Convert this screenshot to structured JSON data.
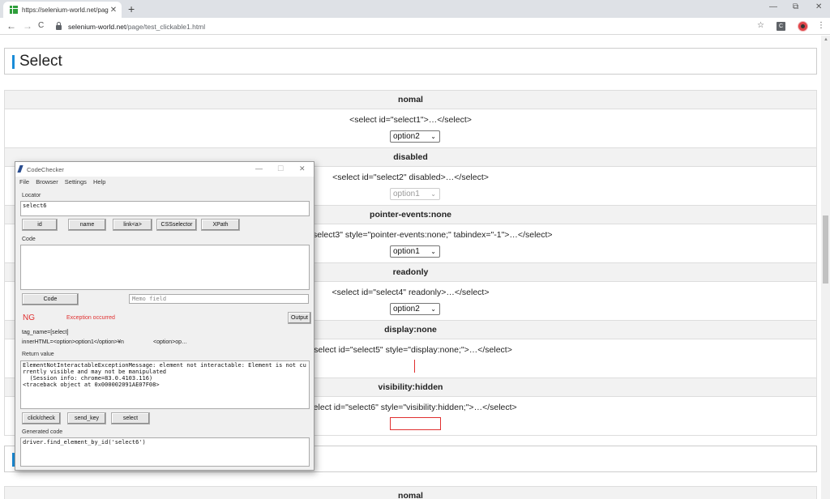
{
  "browser": {
    "tab_title": "https://selenium-world.net/page",
    "tab_close": "✕",
    "new_tab": "+",
    "url_host": "selenium-world.net",
    "url_path": "/page/test_clickable1.html",
    "back": "←",
    "forward": "→",
    "reload": "C",
    "star": "☆",
    "ext_label": "C",
    "menu": "⋮",
    "minimize": "—",
    "restore": "⧉",
    "close": "✕"
  },
  "page": {
    "section_title": "Select",
    "rows": [
      {
        "head": "nomal",
        "code": "<select id=\"select1\">…</select>",
        "select": "option2"
      },
      {
        "head": "disabled",
        "code": "<select id=\"select2\" disabled>…</select>",
        "select": "option1"
      },
      {
        "head": "pointer-events:none",
        "code": "<select id=\"select3\" style=\"pointer-events:none;\" tabindex=\"-1\">…</select>",
        "select": "option1"
      },
      {
        "head": "readonly",
        "code": "<select id=\"select4\" readonly>…</select>",
        "select": "option2"
      },
      {
        "head": "display:none",
        "code": "<select id=\"select5\" style=\"display:none;\">…</select>"
      },
      {
        "head": "visibility:hidden",
        "code": "<select id=\"select6\" style=\"visibility:hidden;\">…</select>"
      }
    ],
    "next_head": "nomal",
    "chevron": "⌄"
  },
  "codechecker": {
    "title": "CodeChecker",
    "win_min": "—",
    "win_max": "☐",
    "win_close": "✕",
    "menu": [
      "File",
      "Browser",
      "Settings",
      "Help"
    ],
    "locator_label": "Locator",
    "locator_value": "select6",
    "locator_buttons": [
      "id",
      "name",
      "link<a>",
      "CSSselector",
      "XPath"
    ],
    "code_label": "Code",
    "code_value": "",
    "code_button": "Code",
    "memo_placeholder": "Memo field",
    "status": "NG",
    "status_message": "Exception occurred",
    "output_button": "Output",
    "tag_name": "tag_name=[select]",
    "inner_html": "innerHTML=<option>option1</option>¥n",
    "inner_html_cont": "<option>op…",
    "return_label": "Return value",
    "return_value": "ElementNotInteractableExceptionMessage: element not interactable: Element is not currently visible and may not be manipulated\n  (Session info: chrome=83.0.4103.116)\n<traceback object at 0x000002091AE07F08>",
    "action_buttons": [
      "click/check",
      "send_key",
      "select"
    ],
    "generated_label": "Generated code",
    "generated_value": "driver.find_element_by_id('select6')"
  }
}
